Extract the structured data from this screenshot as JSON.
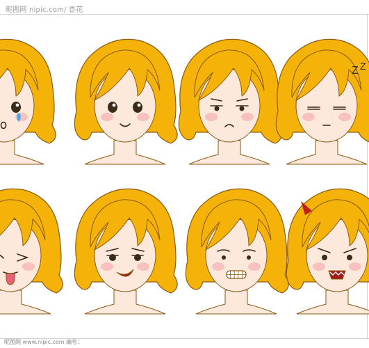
{
  "header_watermark": "昵图网 nipic.com/ 杏花",
  "footer_watermark": "昵图网 www.nipic.com    编号：    ",
  "colors": {
    "hair": "#f5b30a",
    "hair_shade": "#e59a00",
    "outline": "#8a5a10",
    "skin": "#fde9dc",
    "blush": "#f7b9b9",
    "eye": "#3a2a1a",
    "tear": "#4aa8e8",
    "tongue": "#e8607a",
    "horn": "#c0201a"
  },
  "faces": [
    {
      "expression": "crying"
    },
    {
      "expression": "smiling"
    },
    {
      "expression": "worried"
    },
    {
      "expression": "sleeping"
    },
    {
      "expression": "winking-tongue"
    },
    {
      "expression": "smirking"
    },
    {
      "expression": "grinning"
    },
    {
      "expression": "angry-devil"
    }
  ],
  "sleep_text": "Z"
}
